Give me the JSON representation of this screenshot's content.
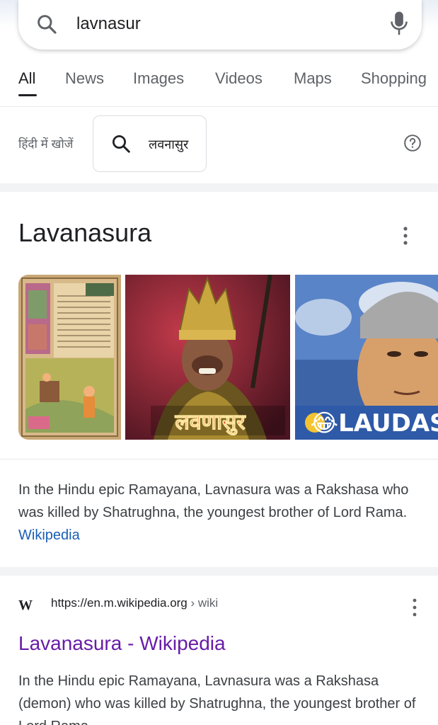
{
  "search": {
    "query": "lavnasur"
  },
  "tabs": [
    {
      "label": "All",
      "active": true
    },
    {
      "label": "News"
    },
    {
      "label": "Images"
    },
    {
      "label": "Videos"
    },
    {
      "label": "Maps"
    },
    {
      "label": "Shopping"
    }
  ],
  "hindi": {
    "label": "हिंदी में खोजें",
    "query": "लवनासुर"
  },
  "knowledge_panel": {
    "title": "Lavanasura",
    "images": [
      {
        "label": ""
      },
      {
        "label": "लवणासुर"
      },
      {
        "label": "😂LAUDAS"
      }
    ],
    "description": "In the Hindu epic Ramayana, Lavnasura was a Rakshasa who was killed by Shatrughna, the youngest brother of Lord Rama.",
    "source_link": "Wikipedia"
  },
  "result": {
    "favicon": "W",
    "url": "https://en.m.wikipedia.org",
    "breadcrumb": " › wiki",
    "title": "Lavanasura - Wikipedia",
    "snippet": "In the Hindu epic Ramayana, Lavnasura was a Rakshasa (demon) who was killed by Shatrughna, the youngest brother of Lord Rama."
  },
  "colors": {
    "link_blue": "#1a5fb4",
    "visited_purple": "#681da8",
    "text": "#202124",
    "secondary": "#5f6368"
  }
}
